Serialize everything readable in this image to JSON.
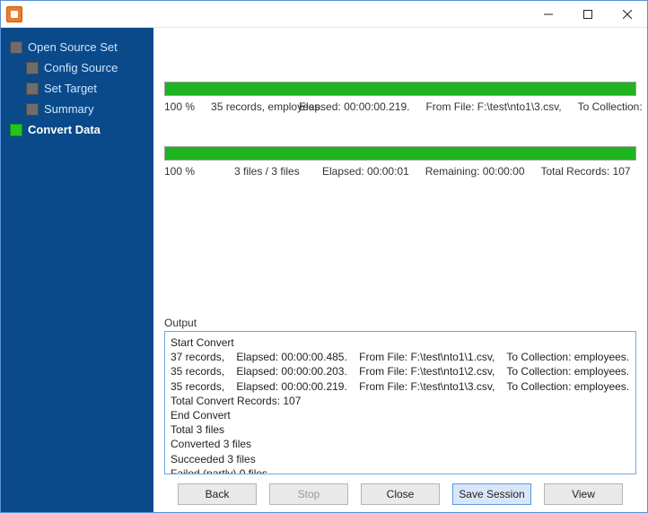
{
  "sidebar": {
    "root": {
      "label": "Open Source Set"
    },
    "items": [
      {
        "label": "Config Source"
      },
      {
        "label": "Set Target"
      },
      {
        "label": "Summary"
      },
      {
        "label": "Convert Data",
        "active": true
      }
    ]
  },
  "progress": {
    "file": {
      "percent": "100 %",
      "records": "35 records, employees.",
      "elapsed": "Elapsed: 00:00:00.219.",
      "from": "From File: F:\\test\\nto1\\3.csv,",
      "to": "To Collection:"
    },
    "total": {
      "percent": "100 %",
      "files": "3 files / 3 files",
      "elapsed": "Elapsed: 00:00:01",
      "remaining": "Remaining: 00:00:00",
      "records": "Total Records: 107"
    }
  },
  "output": {
    "label": "Output",
    "lines": "Start Convert\n37 records,    Elapsed: 00:00:00.485.    From File: F:\\test\\nto1\\1.csv,    To Collection: employees.\n35 records,    Elapsed: 00:00:00.203.    From File: F:\\test\\nto1\\2.csv,    To Collection: employees.\n35 records,    Elapsed: 00:00:00.219.    From File: F:\\test\\nto1\\3.csv,    To Collection: employees.\nTotal Convert Records: 107\nEnd Convert\nTotal 3 files\nConverted 3 files\nSucceeded 3 files\nFailed (partly) 0 files"
  },
  "buttons": {
    "back": "Back",
    "stop": "Stop",
    "close": "Close",
    "save": "Save Session",
    "view": "View"
  }
}
